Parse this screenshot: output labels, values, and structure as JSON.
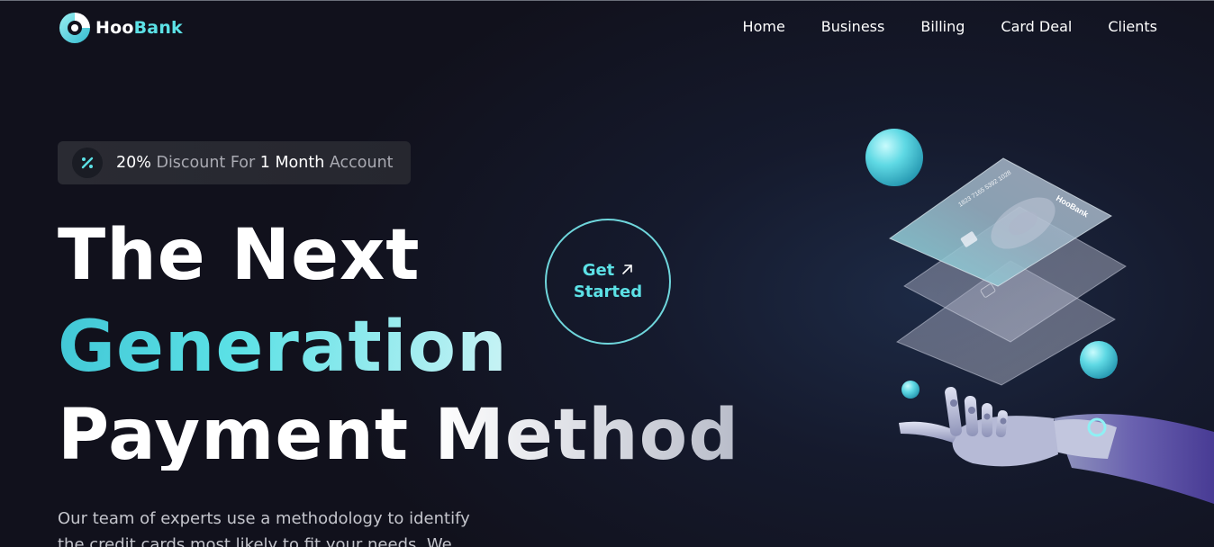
{
  "brand": {
    "name_part1": "Hoo",
    "name_part2": "Bank",
    "accent": "#5ce1e6",
    "icon": "hoobank-logo-icon"
  },
  "nav": {
    "items": [
      {
        "label": "Home"
      },
      {
        "label": "Business"
      },
      {
        "label": "Billing"
      },
      {
        "label": "Card Deal"
      },
      {
        "label": "Clients"
      }
    ]
  },
  "discount": {
    "icon": "percent-icon",
    "value": "20%",
    "text1": " Discount For ",
    "duration": "1 Month",
    "text2": " Account"
  },
  "hero": {
    "line1": "The Next",
    "line2": "Generation",
    "line3": "Payment Method",
    "paragraph": "Our team of experts use a methodology to identify the credit cards most likely to fit your needs. We"
  },
  "cta": {
    "line1": "Get",
    "line2": "Started",
    "icon": "arrow-up-right-icon"
  },
  "card_illustration": {
    "brand_label": "HooBank",
    "card_number": "1823 7165 5392 1028"
  }
}
